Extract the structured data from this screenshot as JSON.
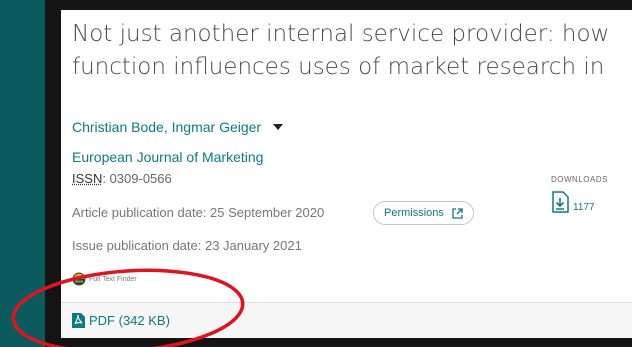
{
  "article": {
    "title_line1": "Not just another internal service provider: how",
    "title_line2": "function influences uses of market research in"
  },
  "meta": {
    "authors": "Christian Bode, Ingmar Geiger",
    "journal": "European Journal of Marketing",
    "issn_label": "ISSN",
    "issn_value": ": 0309-0566",
    "article_date": "Article publication date: 25 September 2020",
    "issue_date": "Issue publication date: 23 January 2021",
    "permissions_label": "Permissions",
    "full_text_finder": "Full Text Finder"
  },
  "downloads": {
    "label": "DOWNLOADS",
    "count": "1177"
  },
  "footer": {
    "pdf_label": "PDF (342 KB)"
  },
  "colors": {
    "accent": "#0d7a84",
    "background_teal": "#0b5a5e",
    "annotation_red": "#e0141e"
  },
  "icons": [
    "chevron-down-icon",
    "external-link-icon",
    "download-icon",
    "full-text-finder-logo",
    "pdf-icon"
  ]
}
